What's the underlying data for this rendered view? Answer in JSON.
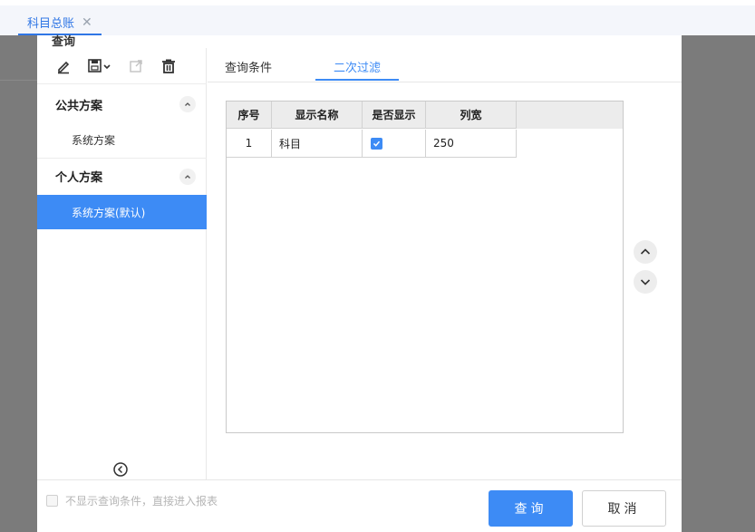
{
  "top_tab": {
    "label": "科目总账",
    "close": "✕"
  },
  "dialog": {
    "title_hint": "查询"
  },
  "sidebar": {
    "toolbar": [
      {
        "name": "edit-icon"
      },
      {
        "name": "save-icon"
      },
      {
        "name": "export-icon"
      },
      {
        "name": "delete-icon"
      }
    ],
    "public_section": "公共方案",
    "public_items": [
      "系统方案"
    ],
    "personal_section": "个人方案",
    "personal_items": [
      "系统方案(默认)"
    ]
  },
  "main": {
    "tabs": [
      "查询条件",
      "二次过滤"
    ],
    "active_tab": "二次过滤",
    "grid": {
      "headers": [
        "序号",
        "显示名称",
        "是否显示",
        "列宽"
      ],
      "rows": [
        {
          "no": "1",
          "name": "科目",
          "show": true,
          "width": "250"
        }
      ]
    }
  },
  "footer": {
    "no_condition_label": "不显示查询条件，直接进入报表",
    "query_button": "查询",
    "cancel_button": "取消"
  },
  "colors": {
    "accent": "#3d8bf5",
    "overlay": "#7b7b7b"
  }
}
